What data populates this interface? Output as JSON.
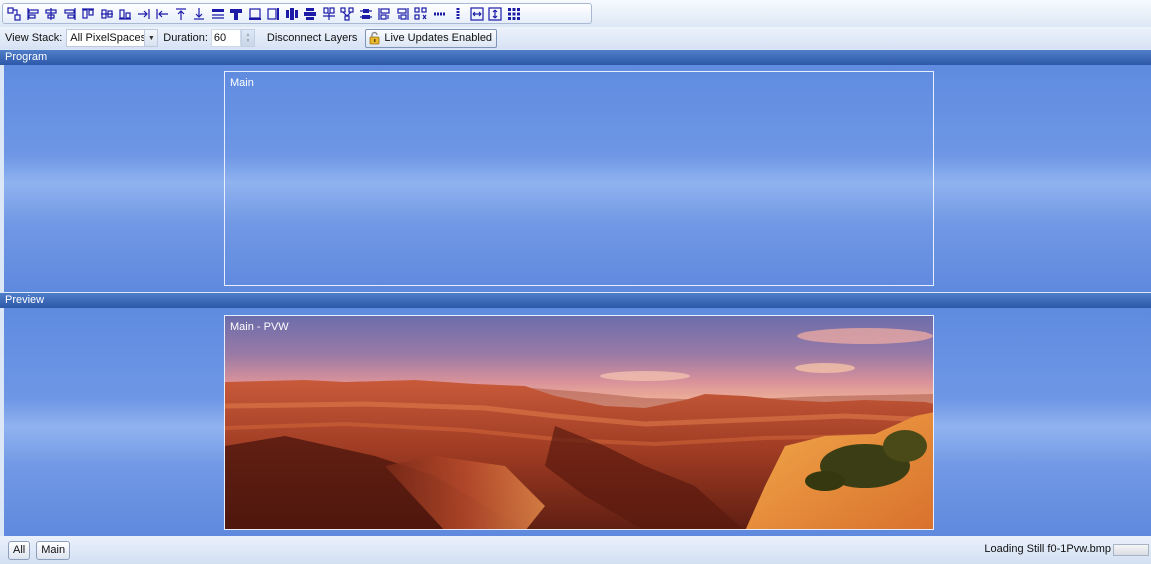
{
  "toolbar": {
    "tools": [
      {
        "name": "arrange-layers-icon"
      },
      {
        "name": "align-left-icon"
      },
      {
        "name": "align-center-icon"
      },
      {
        "name": "align-right-icon"
      },
      {
        "name": "align-top-icon"
      },
      {
        "name": "align-middle-icon"
      },
      {
        "name": "align-bottom-icon"
      },
      {
        "name": "snap-right-icon"
      },
      {
        "name": "snap-left-icon"
      },
      {
        "name": "snap-top-icon"
      },
      {
        "name": "snap-bottom-icon"
      },
      {
        "name": "stretch-top-icon"
      },
      {
        "name": "fill-top-icon"
      },
      {
        "name": "stretch-bottom-icon"
      },
      {
        "name": "stretch-right-icon"
      },
      {
        "name": "distribute-horizontal-icon"
      },
      {
        "name": "distribute-vertical-icon"
      },
      {
        "name": "distribute-top-icon"
      },
      {
        "name": "distribute-spread-icon"
      },
      {
        "name": "space-vertical-icon"
      },
      {
        "name": "space-left-icon"
      },
      {
        "name": "space-right-icon"
      },
      {
        "name": "space-grid-icon"
      },
      {
        "name": "equal-width-icon"
      },
      {
        "name": "equal-height-icon"
      },
      {
        "name": "fit-width-icon"
      },
      {
        "name": "fit-height-icon"
      },
      {
        "name": "grid-layout-icon"
      }
    ]
  },
  "options": {
    "view_stack_label": "View Stack:",
    "view_stack_value": "All PixelSpaces",
    "duration_label": "Duration:",
    "duration_value": "60",
    "disconnect_label": "Disconnect Layers",
    "live_updates_label": "Live Updates Enabled"
  },
  "program": {
    "header": "Program",
    "layer_title": "Main"
  },
  "preview": {
    "header": "Preview",
    "layer_title": "Main - PVW"
  },
  "status": {
    "tab_all": "All",
    "tab_main": "Main",
    "message": "Loading Still f0-1Pvw.bmp"
  },
  "colors": {
    "panel_blue": "#6a93e2",
    "header_blue": "#2d58a8",
    "icon_blue": "#1b1ba8"
  }
}
